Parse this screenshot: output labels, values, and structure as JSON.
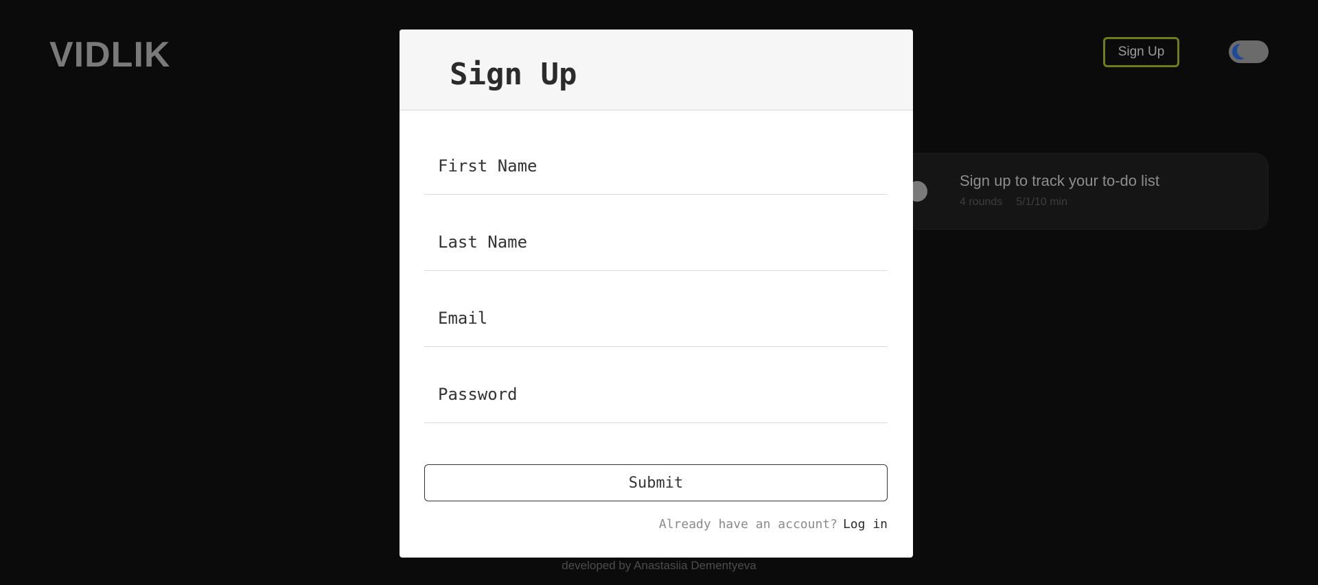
{
  "header": {
    "logo": "VIDLIK",
    "signup_label": "Sign Up",
    "theme_toggle_icon": "moon-icon"
  },
  "task_card": {
    "title": "Sign up to track your to-do list",
    "rounds": "4 rounds",
    "durations": "5/1/10 min"
  },
  "footer": {
    "credit": "developed by Anastasiia Dementyeva"
  },
  "modal": {
    "title": "Sign Up",
    "fields": [
      {
        "placeholder": "First Name",
        "value": ""
      },
      {
        "placeholder": "Last Name",
        "value": ""
      },
      {
        "placeholder": "Email",
        "value": ""
      },
      {
        "placeholder": "Password",
        "value": ""
      }
    ],
    "submit_label": "Submit",
    "login_prompt": "Already have an account?",
    "login_link": "Log in"
  },
  "colors": {
    "background": "#0b0b0b",
    "accent_border": "#6f7f18",
    "moon": "#1e4a9a"
  }
}
